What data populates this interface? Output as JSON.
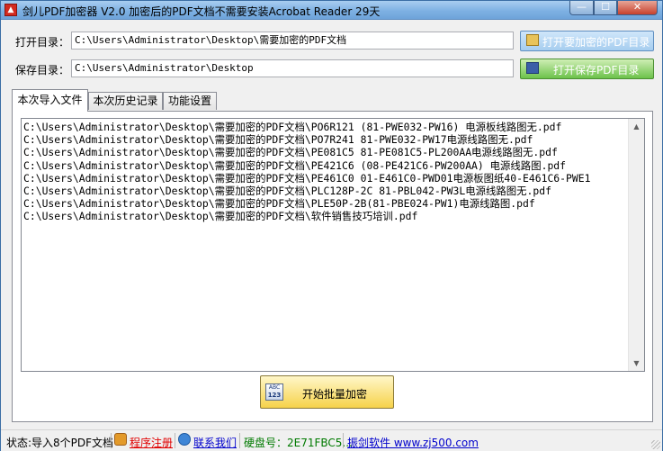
{
  "window": {
    "title": "剑儿PDF加密器 V2.0 加密后的PDF文档不需要安装Acrobat Reader  29天",
    "icon": "pdf-app-icon",
    "controls": {
      "minimize": "—",
      "maximize": "☐",
      "close": "✕"
    }
  },
  "open_dir": {
    "label": "打开目录：",
    "value": "C:\\Users\\Administrator\\Desktop\\需要加密的PDF文档",
    "button_label": "打开要加密的PDF目录",
    "button_icon": "folder-icon"
  },
  "save_dir": {
    "label": "保存目录：",
    "value": "C:\\Users\\Administrator\\Desktop",
    "button_label": "打开保存PDF目录",
    "button_icon": "save-disk-icon"
  },
  "tabs": [
    {
      "label": "本次导入文件",
      "active": true
    },
    {
      "label": "本次历史记录",
      "active": false
    },
    {
      "label": "功能设置",
      "active": false
    }
  ],
  "file_list": [
    "C:\\Users\\Administrator\\Desktop\\需要加密的PDF文档\\PO6R121 (81-PWE032-PW16) 电源板线路图无.pdf",
    "C:\\Users\\Administrator\\Desktop\\需要加密的PDF文档\\PO7R241 81-PWE032-PW17电源线路图无.pdf",
    "C:\\Users\\Administrator\\Desktop\\需要加密的PDF文档\\PE081C5 81-PE081C5-PL200AA电源线路图无.pdf",
    "C:\\Users\\Administrator\\Desktop\\需要加密的PDF文档\\PE421C6 (08-PE421C6-PW200AA) 电源线路图.pdf",
    "C:\\Users\\Administrator\\Desktop\\需要加密的PDF文档\\PE461C0 01-E461C0-PWD01电源板图纸40-E461C6-PWE1",
    "C:\\Users\\Administrator\\Desktop\\需要加密的PDF文档\\PLC128P-2C 81-PBL042-PW3L电源线路图无.pdf",
    "C:\\Users\\Administrator\\Desktop\\需要加密的PDF文档\\PLE50P-2B(81-PBE024-PW1)电源线路图.pdf",
    "C:\\Users\\Administrator\\Desktop\\需要加密的PDF文档\\软件销售技巧培训.pdf"
  ],
  "batch_button": {
    "label": "开始批量加密",
    "icon": "abc-123-icon",
    "icon_top": "ABC",
    "icon_bottom": "123"
  },
  "status": {
    "count_text": "状态:导入8个PDF文档",
    "register_label": "程序注册",
    "contact_label": "联系我们",
    "disk_text": "硬盘号：2E71FBC5...",
    "site_text": "振剑软件 www.zj500.com"
  }
}
